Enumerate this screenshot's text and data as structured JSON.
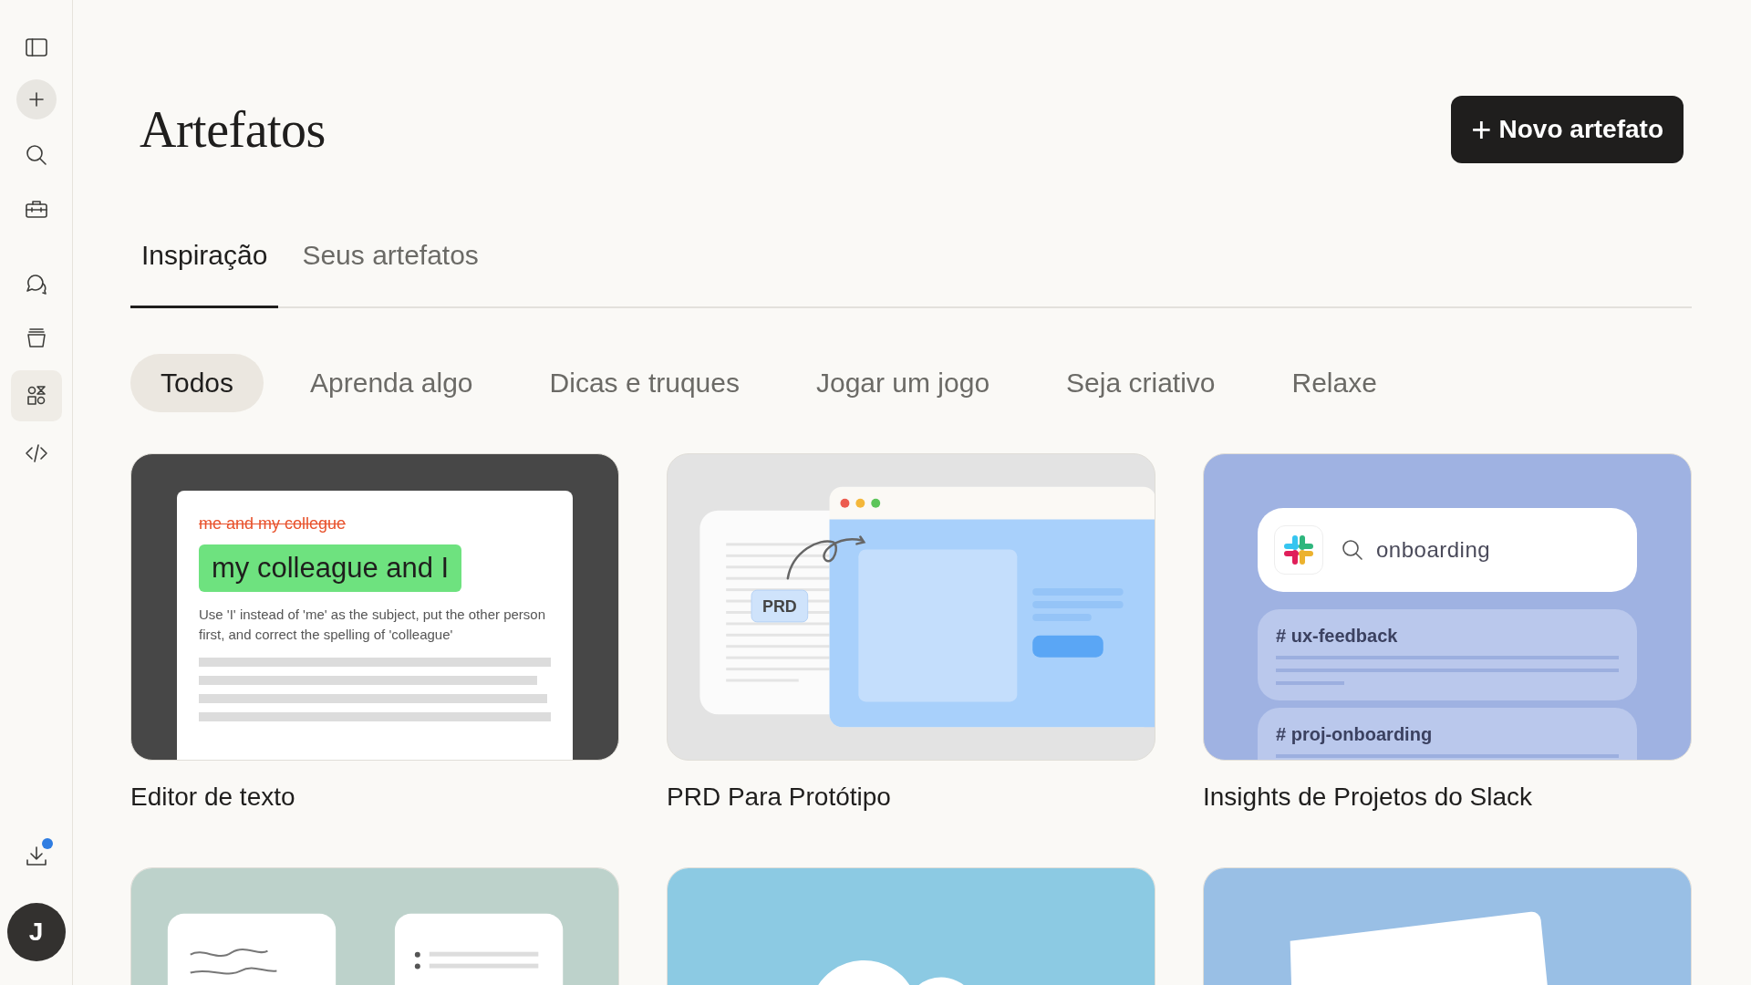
{
  "sidebar": {
    "items": [
      {
        "kind": "panel",
        "selected": false
      },
      {
        "kind": "plus",
        "selected": false
      },
      {
        "kind": "search",
        "selected": false
      },
      {
        "kind": "briefcase",
        "selected": false
      },
      {
        "kind": "chat",
        "selected": false
      },
      {
        "kind": "archive",
        "selected": false
      },
      {
        "kind": "artifacts",
        "selected": true
      },
      {
        "kind": "code",
        "selected": false
      }
    ],
    "download": {
      "has_notification": true
    },
    "avatar": {
      "initial": "J"
    }
  },
  "header": {
    "title": "Artefatos",
    "new_button": {
      "icon": "+",
      "label": "Novo artefato"
    }
  },
  "tabs": [
    {
      "label": "Inspiração",
      "selected": true
    },
    {
      "label": "Seus artefatos",
      "selected": false
    }
  ],
  "filters": [
    {
      "label": "Todos",
      "selected": true
    },
    {
      "label": "Aprenda algo",
      "selected": false
    },
    {
      "label": "Dicas e truques",
      "selected": false
    },
    {
      "label": "Jogar um jogo",
      "selected": false
    },
    {
      "label": "Seja criativo",
      "selected": false
    },
    {
      "label": "Relaxe",
      "selected": false
    }
  ],
  "cards": [
    {
      "kind": "text-editor",
      "title": "Editor de texto",
      "preview": {
        "struck": "me and my collegue",
        "correction": "my colleague and I",
        "note": "Use 'I' instead of 'me' as the subject, put the other person first, and correct the spelling of 'colleague'"
      }
    },
    {
      "kind": "prd",
      "title": "PRD Para Protótipo",
      "preview": {
        "badge": "PRD"
      }
    },
    {
      "kind": "slack",
      "title": "Insights de Projetos do Slack",
      "preview": {
        "query": "onboarding",
        "channels": [
          "# ux-feedback",
          "# proj-onboarding"
        ]
      }
    },
    {
      "kind": "notes"
    },
    {
      "kind": "cloud"
    },
    {
      "kind": "tilted-card"
    }
  ]
}
